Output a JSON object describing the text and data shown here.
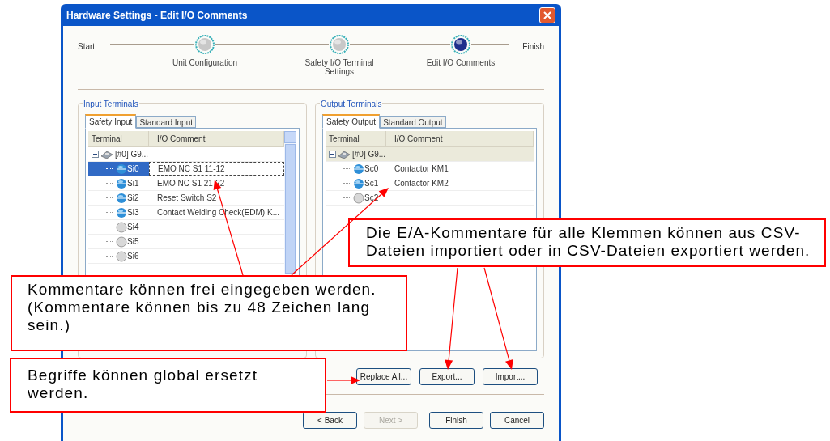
{
  "window": {
    "title": "Hardware Settings - Edit I/O Comments"
  },
  "wizard": {
    "start": "Start",
    "end": "Finish",
    "steps": [
      {
        "label": "Unit Configuration",
        "current": false
      },
      {
        "label": "Safety I/O Terminal Settings",
        "current": false
      },
      {
        "label": "Edit I/O Comments",
        "current": true
      }
    ]
  },
  "input_terminals": {
    "title": "Input Terminals",
    "tabs": [
      {
        "label": "Safety Input",
        "selected": true
      },
      {
        "label": "Standard Input",
        "selected": false
      }
    ],
    "columns": [
      "Terminal",
      "I/O Comment"
    ],
    "root": "[#0] G9...",
    "rows": [
      {
        "terminal": "Si0",
        "comment": "EMO NC S1 11-12",
        "assigned": true,
        "selected": true
      },
      {
        "terminal": "Si1",
        "comment": "EMO NC S1 21-22",
        "assigned": true,
        "selected": false
      },
      {
        "terminal": "Si2",
        "comment": "Reset Switch S2",
        "assigned": true,
        "selected": false
      },
      {
        "terminal": "Si3",
        "comment": "Contact Welding Check(EDM) K...",
        "assigned": true,
        "selected": false
      },
      {
        "terminal": "Si4",
        "assigned": false,
        "selected": false
      },
      {
        "terminal": "Si5",
        "assigned": false,
        "selected": false
      },
      {
        "terminal": "Si6",
        "assigned": false,
        "selected": false
      }
    ]
  },
  "output_terminals": {
    "title": "Output Terminals",
    "tabs": [
      {
        "label": "Safety Output",
        "selected": true
      },
      {
        "label": "Standard Output",
        "selected": false
      }
    ],
    "columns": [
      "Terminal",
      "I/O Comment"
    ],
    "root": "[#0] G9...",
    "rows": [
      {
        "terminal": "Sc0",
        "comment": "Contactor KM1",
        "assigned": true,
        "selected": false
      },
      {
        "terminal": "Sc1",
        "comment": "Contactor KM2",
        "assigned": true,
        "selected": false
      },
      {
        "terminal": "Sc2",
        "assigned": false,
        "selected": false
      }
    ]
  },
  "action_buttons": [
    {
      "label": "Replace All...",
      "disabled": false
    },
    {
      "label": "Export...",
      "disabled": false
    },
    {
      "label": "Import...",
      "disabled": false
    }
  ],
  "nav_buttons": [
    {
      "label": "< Back",
      "disabled": false
    },
    {
      "label": "Next >",
      "disabled": true
    },
    {
      "label": "Finish",
      "disabled": false
    },
    {
      "label": "Cancel",
      "disabled": false
    }
  ],
  "callouts": [
    {
      "text": "Die E/A-Kommentare für alle Klemmen können aus CSV-Dateien importiert oder in CSV-Dateien exportiert werden."
    },
    {
      "text": "Kommentare können frei eingegeben werden. (Kommentare können bis zu 48 Zeichen lang sein.)"
    },
    {
      "text": "Begriffe können global ersetzt werden."
    }
  ]
}
